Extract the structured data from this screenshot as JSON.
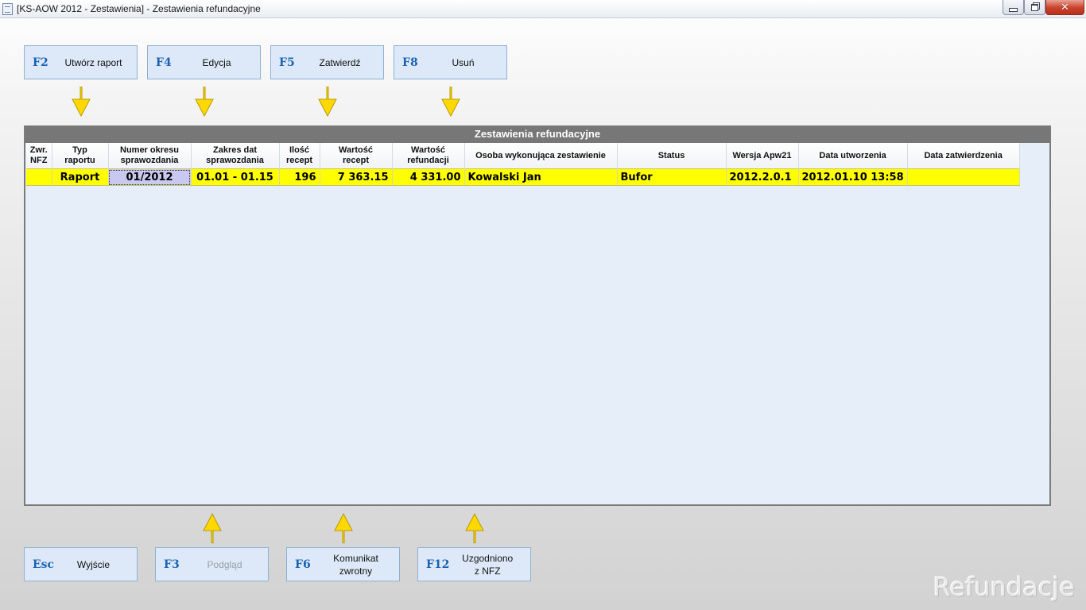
{
  "window": {
    "title": "[KS-AOW 2012 - Zestawienia] - Zestawienia refundacyjne",
    "close_glyph": "✕"
  },
  "top_keys": [
    {
      "key": "F2",
      "label": "Utwórz raport"
    },
    {
      "key": "F4",
      "label": "Edycja"
    },
    {
      "key": "F5",
      "label": "Zatwierdź"
    },
    {
      "key": "F8",
      "label": "Usuń"
    }
  ],
  "bottom_keys": [
    {
      "key": "Esc",
      "label": "Wyjście"
    },
    {
      "key": "F3",
      "label": "Podgląd"
    },
    {
      "key": "F6",
      "label_line1": "Komunikat",
      "label_line2": "zwrotny"
    },
    {
      "key": "F12",
      "label_line1": "Uzgodniono",
      "label_line2": "z NFZ"
    }
  ],
  "panel": {
    "title": "Zestawienia refundacyjne"
  },
  "table": {
    "headers": [
      {
        "l1": "Zwr.",
        "l2": "NFZ"
      },
      {
        "l1": "Typ",
        "l2": "raportu"
      },
      {
        "l1": "Numer okresu",
        "l2": "sprawozdania"
      },
      {
        "l1": "Zakres dat",
        "l2": "sprawozdania"
      },
      {
        "l1": "Ilość",
        "l2": "recept"
      },
      {
        "l1": "Wartość",
        "l2": "recept"
      },
      {
        "l1": "Wartość",
        "l2": "refundacji"
      },
      {
        "l1": "Osoba wykonująca zestawienie",
        "l2": ""
      },
      {
        "l1": "Status",
        "l2": ""
      },
      {
        "l1": "Wersja Apw21",
        "l2": ""
      },
      {
        "l1": "Data utworzenia",
        "l2": ""
      },
      {
        "l1": "Data zatwierdzenia",
        "l2": ""
      }
    ],
    "rows": [
      {
        "zwr_nfz": "",
        "typ": "Raport",
        "numer": "01/2012",
        "zakres": "01.01 - 01.15",
        "ilosc": "196",
        "wartosc_recept": "7 363.15",
        "wartosc_refundacji": "4 331.00",
        "osoba": "Kowalski Jan",
        "status": "Bufor",
        "wersja": "2012.2.0.1",
        "data_utworzenia": "2012.01.10 13:58",
        "data_zatwierdzenia": ""
      }
    ],
    "row_color": "#ffff00"
  },
  "watermark": "Refundacje",
  "colors": {
    "key_text": "#1a63b4",
    "button_bg": "#dde9f8",
    "arrow_fill": "#ffd800",
    "panel_header": "#777777"
  }
}
